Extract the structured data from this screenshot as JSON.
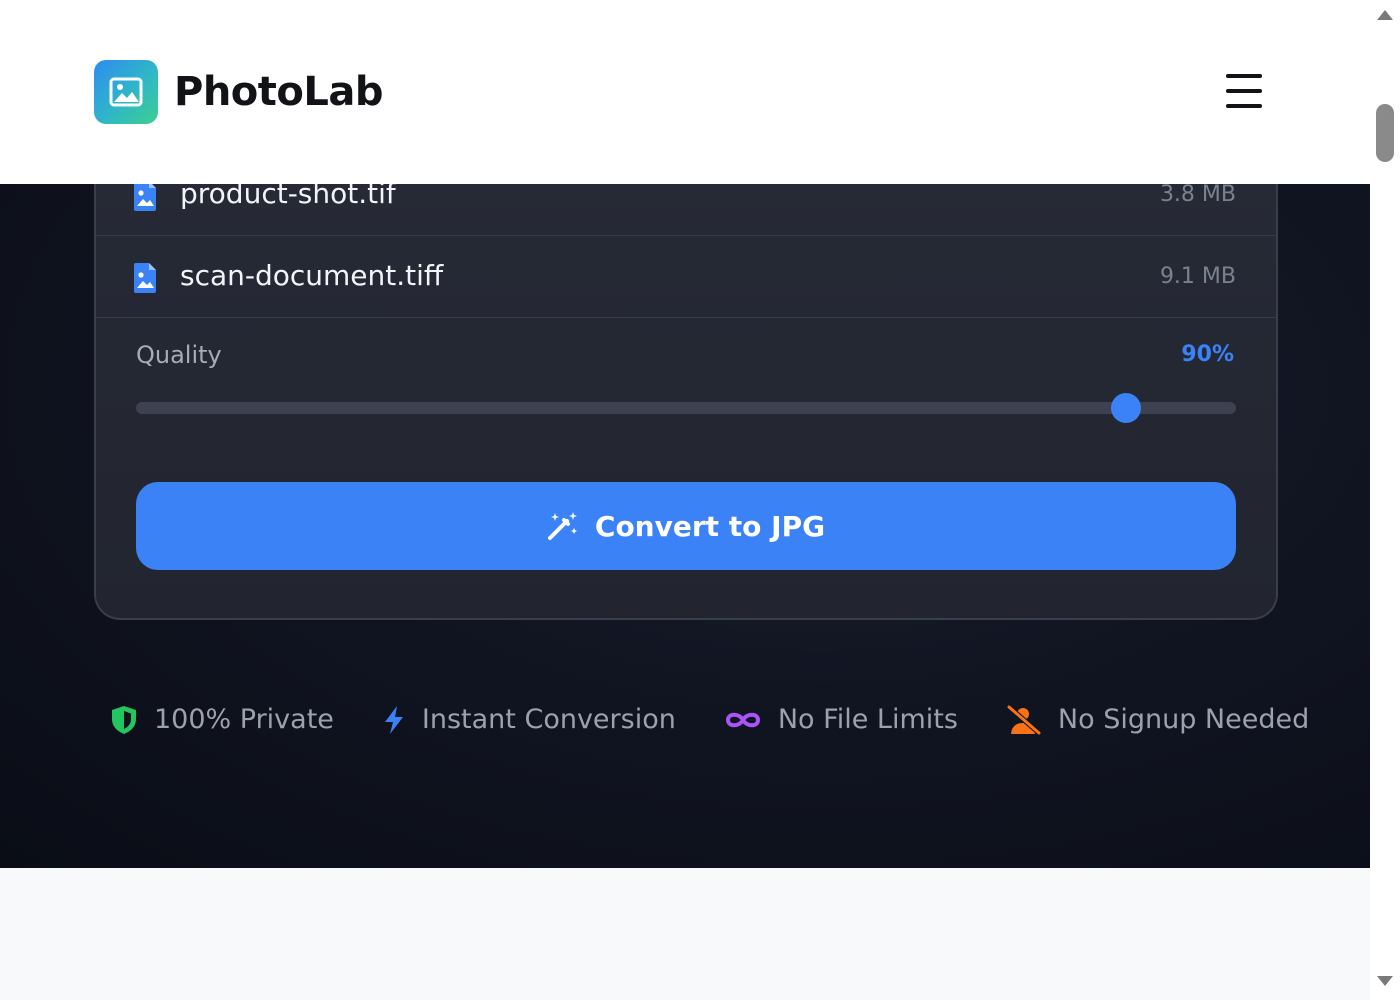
{
  "header": {
    "brand": "PhotoLab",
    "logo_icon": "image-icon",
    "menu_icon": "hamburger-menu-icon"
  },
  "files": [
    {
      "name": "product-shot.tif",
      "size": "3.8 MB",
      "icon": "file-image-icon"
    },
    {
      "name": "scan-document.tiff",
      "size": "9.1 MB",
      "icon": "file-image-icon"
    }
  ],
  "quality": {
    "label": "Quality",
    "value_label": "90%",
    "value_fraction": 0.9
  },
  "convert_button": {
    "label": "Convert to JPG",
    "icon": "magic-wand-icon"
  },
  "features": [
    {
      "label": "100% Private",
      "icon": "shield-icon",
      "color": "#22c55e"
    },
    {
      "label": "Instant Conversion",
      "icon": "bolt-icon",
      "color": "#3b82f6"
    },
    {
      "label": "No File Limits",
      "icon": "infinity-icon",
      "color": "#a855f7"
    },
    {
      "label": "No Signup Needed",
      "icon": "user-slash-icon",
      "color": "#f97316"
    }
  ],
  "colors": {
    "accent": "#3b82f6",
    "card_bg": "#262a36",
    "page_dark": "#0f1320"
  }
}
